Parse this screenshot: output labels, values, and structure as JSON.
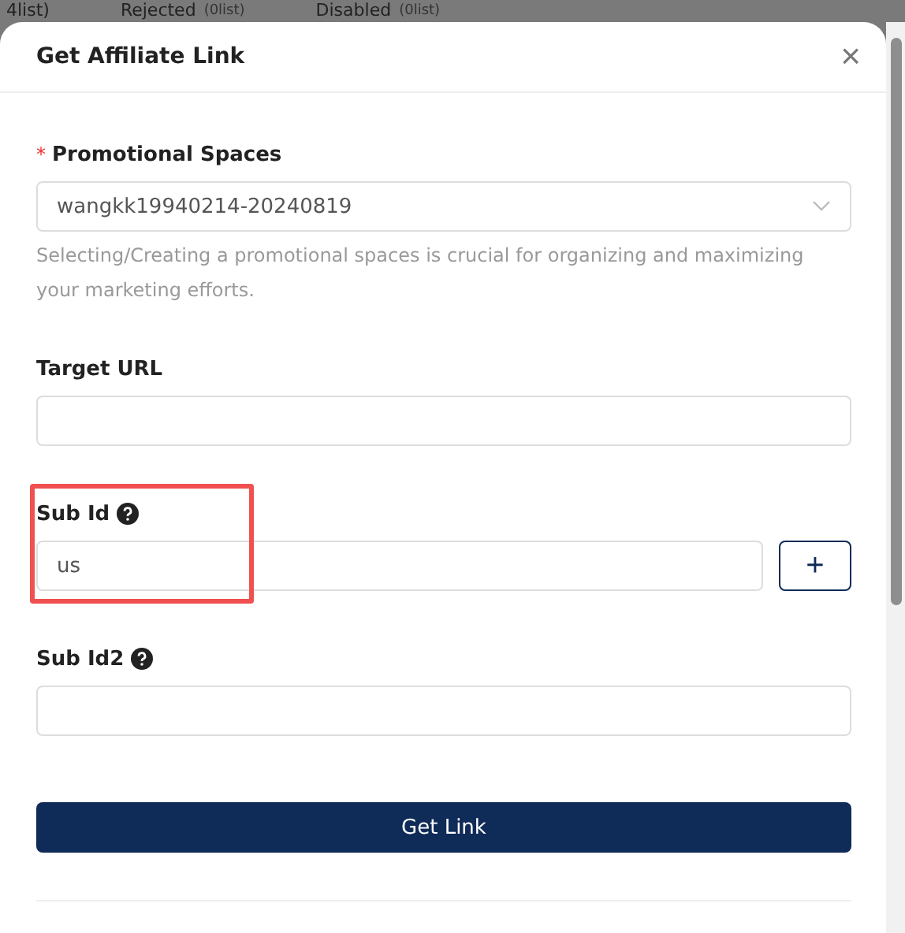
{
  "background_tabs": [
    {
      "label": "4list)"
    },
    {
      "label": "Rejected",
      "count": "(0list)"
    },
    {
      "label": "Disabled",
      "count": "(0list)"
    }
  ],
  "dialog": {
    "title": "Get Affiliate Link",
    "close": "×"
  },
  "fields": [
    {
      "kind": "select",
      "required_mark": "*",
      "label": "Promotional Spaces",
      "value": "wangkk19940214-20240819",
      "help_text": "Selecting/Creating a promotional spaces is crucial for organizing and maximizing your marketing efforts.",
      "info": false,
      "highlighted": false
    },
    {
      "kind": "input",
      "label": "Target URL",
      "info": false,
      "highlighted": false
    },
    {
      "kind": "input_add",
      "label": "Sub Id",
      "value": "us",
      "info": true,
      "highlighted": true,
      "add_button": "+"
    },
    {
      "kind": "input",
      "label": "Sub Id2",
      "info": true,
      "highlighted": false
    }
  ],
  "submit_button": "Get Link"
}
